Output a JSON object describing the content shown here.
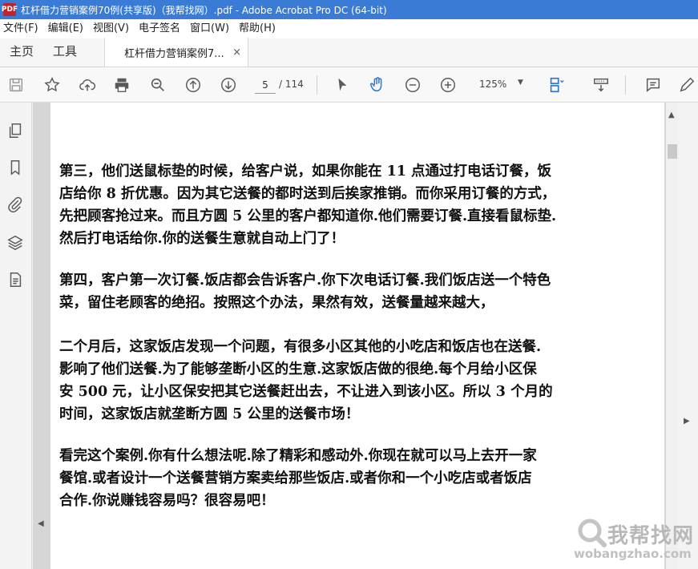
{
  "window": {
    "title": "杠杆借力营销案例70例(共享版)（我帮找网）.pdf - Adobe Acrobat Pro DC (64-bit)",
    "app_icon": "PDF"
  },
  "menu": [
    "文件(F)",
    "编辑(E)",
    "视图(V)",
    "电子签名",
    "窗口(W)",
    "帮助(H)"
  ],
  "tabs": {
    "home": "主页",
    "tools": "工具",
    "document": "杠杆借力营销案例7...",
    "close": "×"
  },
  "toolbar": {
    "page_current": "5",
    "page_total": "/ 114",
    "zoom": "125%",
    "icons": [
      "save-icon",
      "star-icon",
      "cloud-upload-icon",
      "print-icon",
      "find-icon",
      "page-up-icon",
      "page-down-icon",
      "select-arrow-icon",
      "hand-icon",
      "zoom-out-icon",
      "zoom-in-icon",
      "fit-page-icon",
      "scroll-mode-icon",
      "comment-icon",
      "pen-icon"
    ]
  },
  "left_panel": {
    "icons": [
      "page-thumbnails-icon",
      "bookmark-icon",
      "attachment-icon",
      "layers-icon",
      "document-properties-icon"
    ]
  },
  "document": {
    "paragraphs": [
      [
        "第三，他们送鼠标垫的时候，给客户说，如果你能在 11 点通过打电话订餐，饭",
        "店给你 8 折优惠。因为其它送餐的都时送到后挨家推销。而你采用订餐的方式，",
        "先把顾客抢过来。而且方圆 5 公里的客户都知道你.他们需要订餐.直接看鼠标垫.",
        "然后打电话给你.你的送餐生意就自动上门了！"
      ],
      [
        "第四，客户第一次订餐.饭店都会告诉客户.你下次电话订餐.我们饭店送一个特色",
        "菜，留住老顾客的绝招。按照这个办法，果然有效，送餐量越来越大，"
      ],
      [
        "二个月后，这家饭店发现一个问题，有很多小区其他的小吃店和饭店也在送餐.",
        "影响了他们送餐.为了能够垄断小区的生意.这家饭店做的很绝.每个月给小区保",
        "安 500  元，让小区保安把其它送餐赶出去，不让进入到该小区。所以 3 个月的",
        "时间，这家饭店就垄断方圆 5 公里的送餐市场！"
      ],
      [
        "看完这个案例.你有什么想法呢.除了精彩和感动外.你现在就可以马上去开一家",
        "餐馆.或者设计一个送餐营销方案卖给那些饭店.或者你和一个小吃店或者饭店",
        "合作.你说赚钱容易吗？很容易吧！"
      ]
    ]
  },
  "watermark": {
    "cn": "我帮找网",
    "en": "wobangzhao.com"
  },
  "colors": {
    "titlebar": "#3a7bd5",
    "icon_gray": "#5a5a5a",
    "hand_active": "#2f74d0",
    "fit_active": "#2f74d0"
  }
}
